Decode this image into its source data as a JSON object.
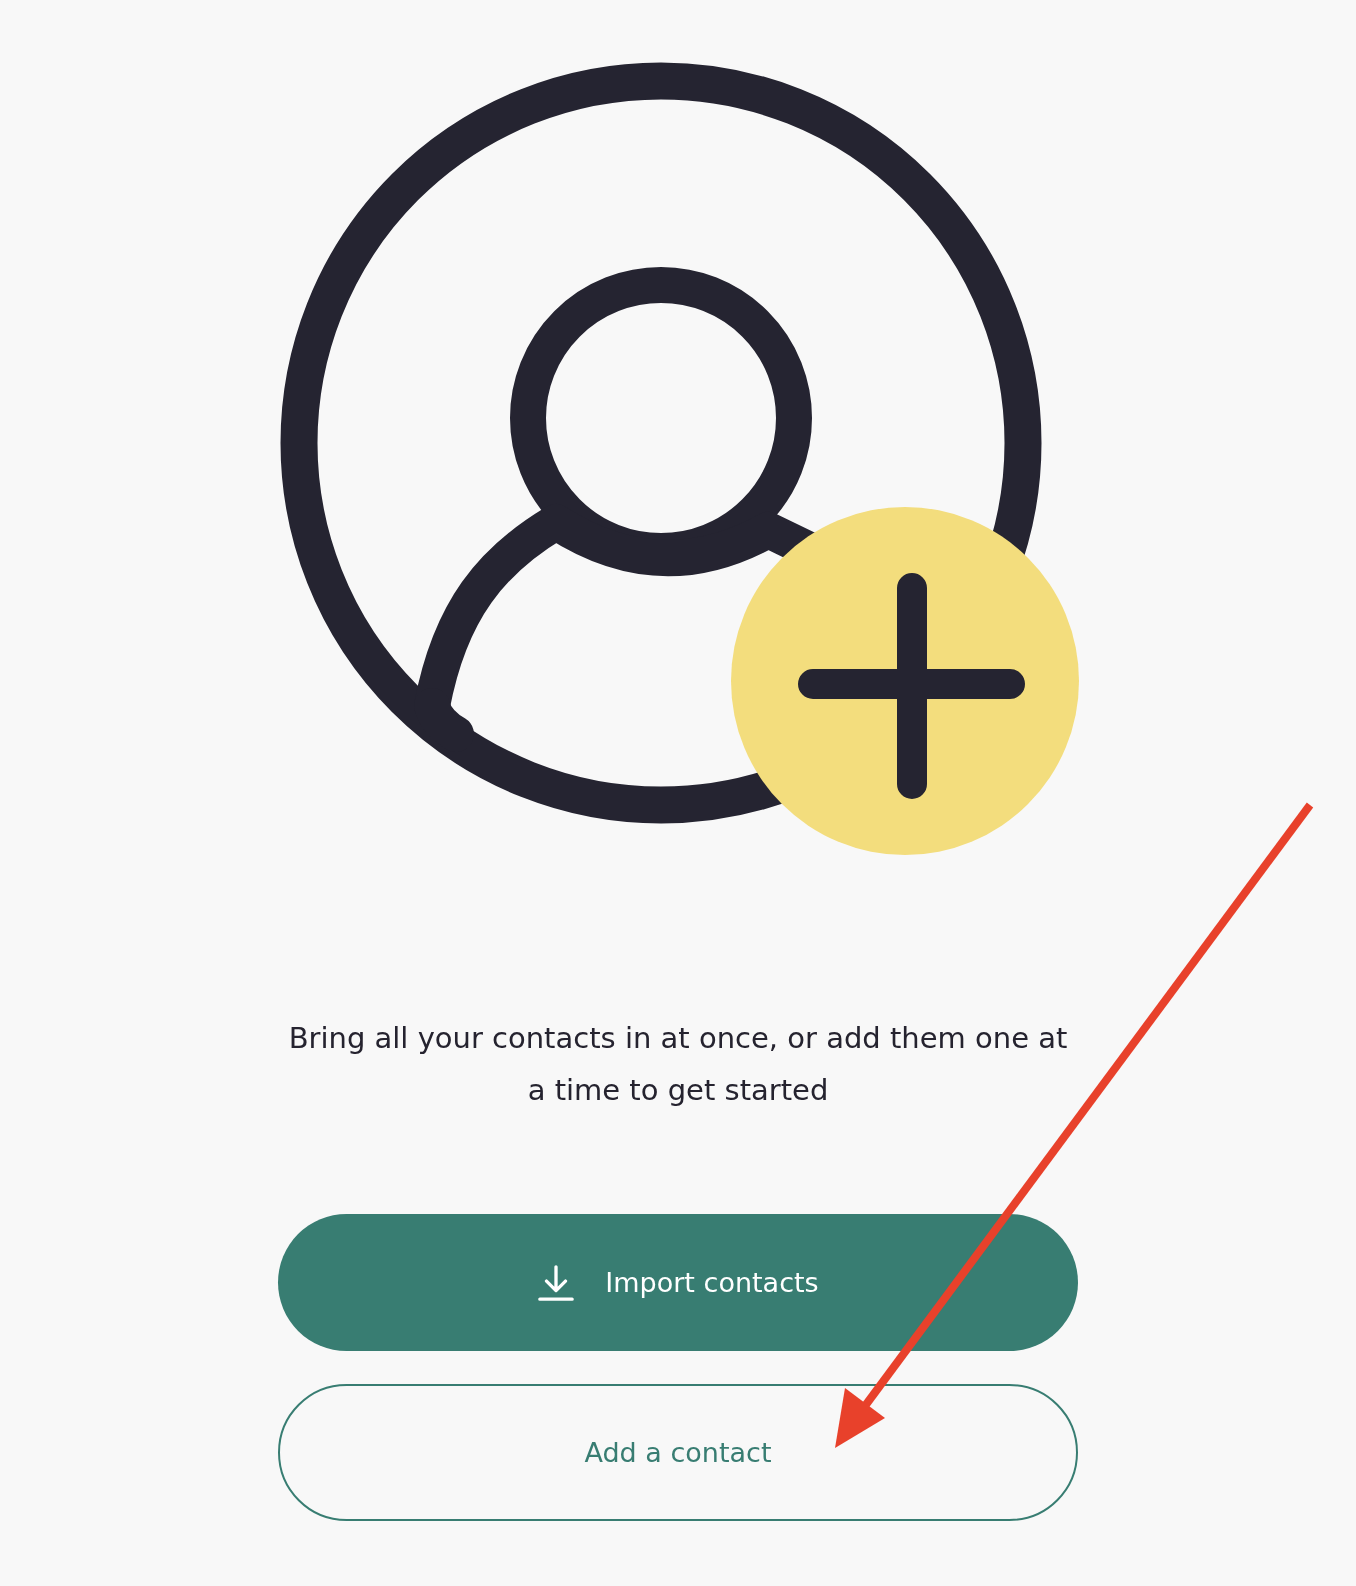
{
  "message": "Bring all your contacts in at once, or add them one at a time to get started",
  "buttons": [
    {
      "kind": "primary",
      "label": "Import contacts"
    },
    {
      "kind": "secondary",
      "label": "Add a contact"
    }
  ]
}
